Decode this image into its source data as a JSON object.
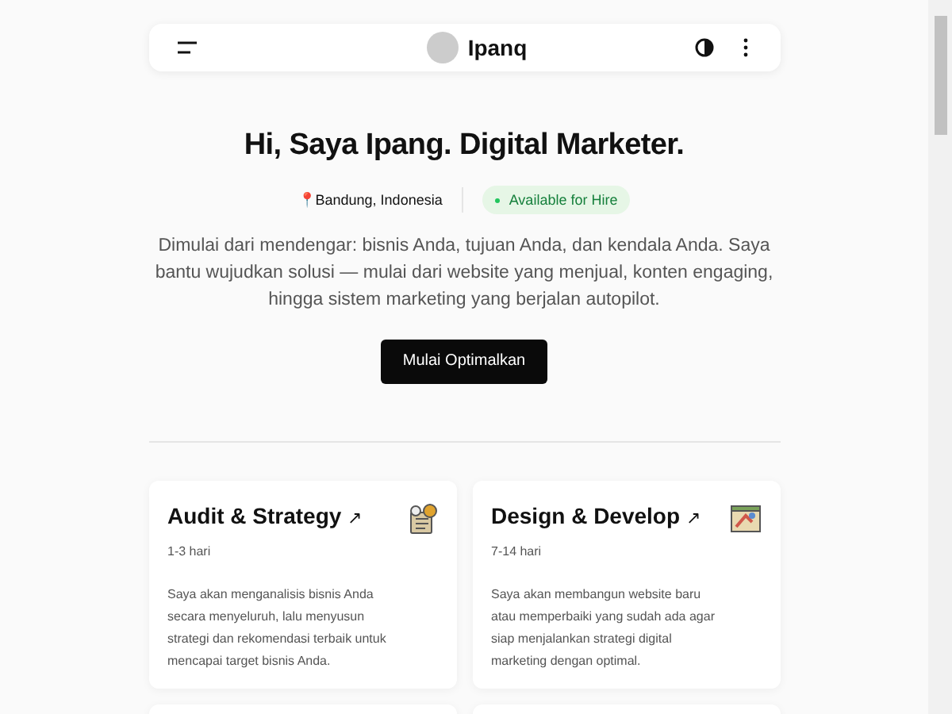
{
  "navbar": {
    "brand": "Ipanq"
  },
  "hero": {
    "title": "Hi, Saya Ipang. Digital Marketer.",
    "location_pin": "📍",
    "location": "Bandung, Indonesia",
    "status": "Available for Hire",
    "description": "Dimulai dari mendengar: bisnis Anda, tujuan Anda, dan kendala Anda. Saya bantu wujudkan solusi — mulai dari website yang menjual, konten engaging, hingga sistem marketing yang berjalan autopilot.",
    "button": "Mulai Optimalkan"
  },
  "services": [
    {
      "title": "Audit & Strategy",
      "arrow": "↗",
      "duration": "1-3 hari",
      "description": "Saya akan menganalisis bisnis Anda secara menyeluruh, lalu menyusun strategi dan rekomendasi terbaik untuk mencapai target bisnis Anda.",
      "kind": "audit"
    },
    {
      "title": "Design & Develop",
      "arrow": "↗",
      "duration": "7-14 hari",
      "description": "Saya akan membangun website baru atau memperbaiki yang sudah ada agar siap menjalankan strategi digital marketing dengan optimal.",
      "kind": "design"
    }
  ]
}
